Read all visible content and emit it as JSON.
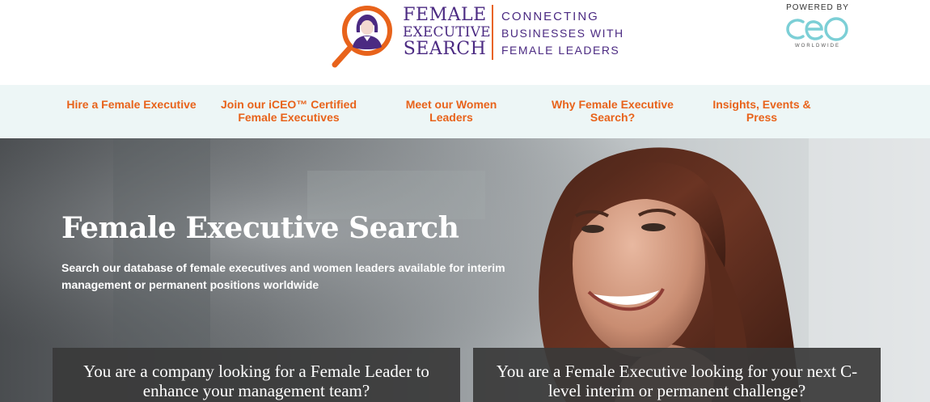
{
  "header": {
    "logo": {
      "name_line1": "FEMALE",
      "name_line2": "EXECUTIVE",
      "name_line3": "SEARCH",
      "tagline_line1": "CONNECTING",
      "tagline_line2": "BUSINESSES WITH",
      "tagline_line3": "FEMALE LEADERS",
      "icon": "magnifier-woman-icon"
    },
    "powered_by": {
      "label": "POWERED BY",
      "brand": "ceo",
      "brand_sub": "WORLDWIDE",
      "icon": "ceo-worldwide-logo"
    }
  },
  "nav": {
    "items": [
      {
        "label": "Hire a Female Executive"
      },
      {
        "label": "Join our iCEO™ Certified Female Executives"
      },
      {
        "label": "Meet our Women Leaders"
      },
      {
        "label": "Why Female Executive Search?"
      },
      {
        "label": "Insights, Events & Press"
      }
    ]
  },
  "hero": {
    "title": "Female Executive Search",
    "subtitle": "Search our database of female executives and women leaders available for interim management or permanent positions worldwide",
    "cta_company": "You are a company looking for a Female Leader to enhance your management team?",
    "cta_executive": "You are a Female Executive looking for your next C-level interim or permanent challenge?"
  },
  "colors": {
    "brand_purple": "#4b2a82",
    "accent_orange": "#e8631b",
    "nav_bg": "#edf6f6",
    "ceo_teal": "#7ccfd6",
    "cta_bg": "#3a3a3a"
  }
}
